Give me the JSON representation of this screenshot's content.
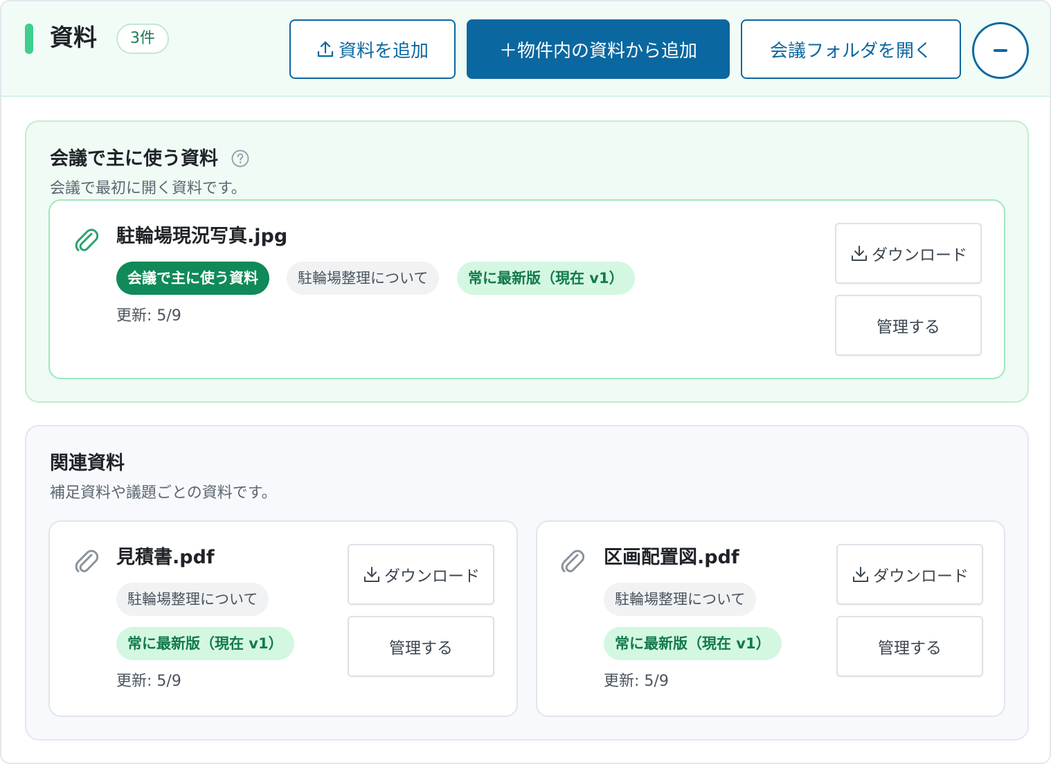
{
  "header": {
    "title": "資料",
    "count_badge": "3件",
    "add_button": "資料を追加",
    "add_from_property_button": "＋物件内の資料から追加",
    "open_folder_button": "会議フォルダを開く",
    "collapse_icon": "minus-icon"
  },
  "main_section": {
    "title": "会議で主に使う資料",
    "description": "会議で最初に開く資料です。",
    "help_icon": "question-circle-icon",
    "file": {
      "name": "駐輪場現況写真.jpg",
      "tags": [
        "会議で主に使う資料",
        "駐輪場整理について",
        "常に最新版（現在 v1）"
      ],
      "updated": "更新: 5/9",
      "download_label": "ダウンロード",
      "manage_label": "管理する"
    }
  },
  "related_section": {
    "title": "関連資料",
    "description": "補足資料や議題ごとの資料です。",
    "files": [
      {
        "name": "見積書.pdf",
        "tags": [
          "駐輪場整理について",
          "常に最新版（現在 v1）"
        ],
        "updated": "更新: 5/9",
        "download_label": "ダウンロード",
        "manage_label": "管理する"
      },
      {
        "name": "区画配置図.pdf",
        "tags": [
          "駐輪場整理について",
          "常に最新版（現在 v1）"
        ],
        "updated": "更新: 5/9",
        "download_label": "ダウンロード",
        "manage_label": "管理する"
      }
    ]
  },
  "colors": {
    "brand_blue": "#0b67a0",
    "accent_green": "#3ecf8e",
    "tag_green": "#0f8a58",
    "tag_mint": "#d4f7e2"
  }
}
